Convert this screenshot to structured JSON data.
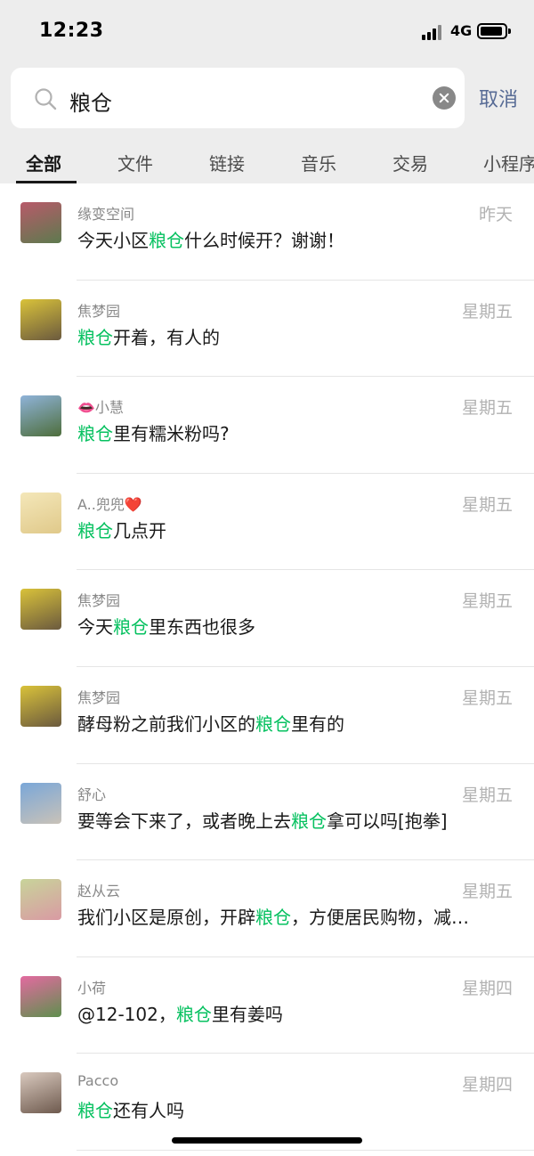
{
  "status_bar": {
    "time": "12:23",
    "network": "4G"
  },
  "search": {
    "query": "粮仓",
    "cancel_label": "取消"
  },
  "tabs": [
    {
      "label": "全部"
    },
    {
      "label": "文件"
    },
    {
      "label": "链接"
    },
    {
      "label": "音乐"
    },
    {
      "label": "交易"
    },
    {
      "label": "小程序"
    }
  ],
  "messages": [
    {
      "sender": "缘变空间",
      "date": "昨天",
      "pre": "今天小区",
      "hl": "粮仓",
      "post": "什么时候开？谢谢！",
      "avatar_colors": [
        "#b85a6a",
        "#5d7a4e"
      ]
    },
    {
      "sender": "焦梦园",
      "date": "星期五",
      "pre": "",
      "hl": "粮仓",
      "post": "开着，有人的",
      "avatar_colors": [
        "#d9c23a",
        "#6b5a3e"
      ]
    },
    {
      "sender": "👄小慧",
      "date": "星期五",
      "pre": "",
      "hl": "粮仓",
      "post": "里有糯米粉吗?",
      "avatar_colors": [
        "#8fb3d9",
        "#4e6e3c"
      ]
    },
    {
      "sender": "A..兜兜❤️",
      "date": "星期五",
      "pre": "",
      "hl": "粮仓",
      "post": "几点开",
      "avatar_colors": [
        "#f4e7b9",
        "#e0c98a"
      ]
    },
    {
      "sender": "焦梦园",
      "date": "星期五",
      "pre": "今天",
      "hl": "粮仓",
      "post": "里东西也很多",
      "avatar_colors": [
        "#d9c23a",
        "#6b5a3e"
      ]
    },
    {
      "sender": "焦梦园",
      "date": "星期五",
      "pre": "酵母粉之前我们小区的",
      "hl": "粮仓",
      "post": "里有的",
      "avatar_colors": [
        "#d9c23a",
        "#6b5a3e"
      ]
    },
    {
      "sender": "舒心",
      "date": "星期五",
      "pre": "要等会下来了，或者晚上去",
      "hl": "粮仓",
      "post": "拿可以吗[抱拳]",
      "avatar_colors": [
        "#7aa7d8",
        "#c9c2b8"
      ]
    },
    {
      "sender": "赵从云",
      "date": "星期五",
      "pre": "我们小区是原创，开辟",
      "hl": "粮仓",
      "post": "，方便居民购物，减…",
      "avatar_colors": [
        "#c8d49a",
        "#d99aa3"
      ]
    },
    {
      "sender": "小荷",
      "date": "星期四",
      "pre": "@12-102，",
      "hl": "粮仓",
      "post": "里有姜吗",
      "avatar_colors": [
        "#e36aa0",
        "#5f8f4e"
      ]
    },
    {
      "sender": "Pacco",
      "date": "星期四",
      "pre": "",
      "hl": "粮仓",
      "post": "还有人吗",
      "avatar_colors": [
        "#d9c9be",
        "#6e5a4e"
      ]
    }
  ]
}
